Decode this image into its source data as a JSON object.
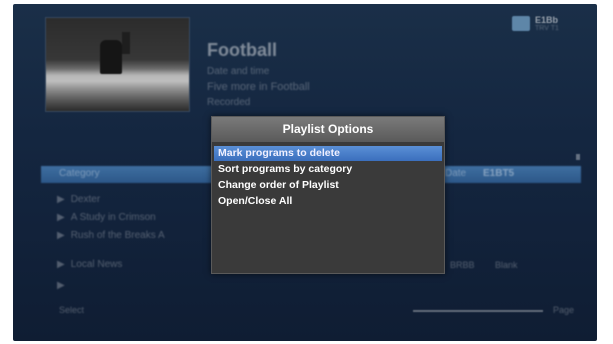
{
  "program": {
    "title": "Football",
    "line1": "Date and time",
    "line2": "Five more in Football",
    "line3": "Recorded"
  },
  "channel": {
    "logo_text": "E1Bb",
    "logo_sub": "TRV T1"
  },
  "list_header": {
    "category": "Category",
    "date": "Date",
    "code": "E1BT5"
  },
  "list_rows": [
    {
      "title": "Dexter"
    },
    {
      "title": "A Study in Crimson"
    },
    {
      "title": "Rush of the Breaks A"
    },
    {
      "title": "Local News",
      "col1": "BRBB",
      "col2": "Blank"
    },
    {
      "title": ""
    }
  ],
  "footer": {
    "left": "Select",
    "right": "Page"
  },
  "dialog": {
    "title": "Playlist Options",
    "options": [
      "Mark programs to delete",
      "Sort programs by category",
      "Change order of Playlist",
      "Open/Close All"
    ],
    "selected_index": 0
  },
  "colors": {
    "background": "#142640",
    "dialog_bg": "#3a3a3a",
    "dialog_title_bg": "#6a6a6a",
    "selection": "#4a7fcc",
    "list_header": "#345f92"
  }
}
